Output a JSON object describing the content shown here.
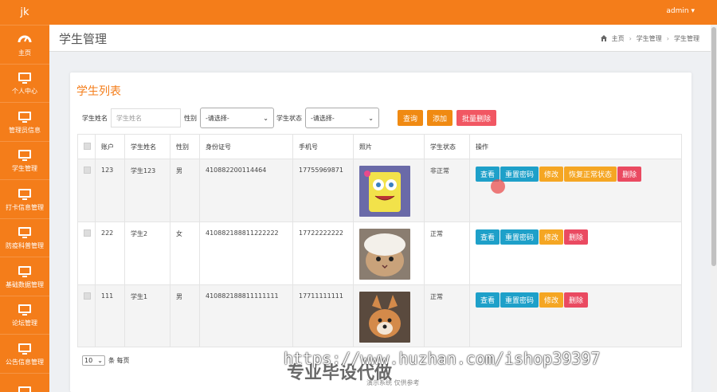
{
  "sidebar": {
    "logo": "jk",
    "items": [
      {
        "label": "主页",
        "icon": "dashboard-icon"
      },
      {
        "label": "个人中心",
        "icon": "monitor-icon"
      },
      {
        "label": "管理员信息",
        "icon": "monitor-icon"
      },
      {
        "label": "学生管理",
        "icon": "monitor-icon"
      },
      {
        "label": "打卡信息管理",
        "icon": "monitor-icon"
      },
      {
        "label": "防疫科普管理",
        "icon": "monitor-icon"
      },
      {
        "label": "基础数据管理",
        "icon": "monitor-icon"
      },
      {
        "label": "论坛管理",
        "icon": "monitor-icon"
      },
      {
        "label": "公告信息管理",
        "icon": "monitor-icon"
      },
      {
        "label": "",
        "icon": "monitor-icon"
      }
    ]
  },
  "topbar": {
    "user": "admin ▾"
  },
  "page": {
    "title": "学生管理",
    "breadcrumb": {
      "home": "主页",
      "b1": "学生管理",
      "b2": "学生管理",
      "sep": "›"
    }
  },
  "card": {
    "title": "学生列表"
  },
  "filters": {
    "name_label": "学生姓名",
    "name_placeholder": "学生姓名",
    "gender_label": "性别",
    "gender_value": "-请选择-",
    "status_label": "学生状态",
    "status_value": "-请选择-",
    "query": "查询",
    "add": "添加",
    "batch_delete": "批量删除"
  },
  "table": {
    "headers": [
      "账户",
      "学生姓名",
      "性别",
      "身份证号",
      "手机号",
      "照片",
      "学生状态",
      "操作"
    ],
    "rows": [
      {
        "account": "123",
        "name": "学生123",
        "gender": "男",
        "id": "410882200114464",
        "phone": "17755969871",
        "status": "非正常"
      },
      {
        "account": "222",
        "name": "学生2",
        "gender": "女",
        "id": "410882188811222222",
        "phone": "17722222222",
        "status": "正常"
      },
      {
        "account": "111",
        "name": "学生1",
        "gender": "男",
        "id": "410882188811111111",
        "phone": "17711111111",
        "status": "正常"
      }
    ],
    "ops": {
      "view": "查看",
      "reset": "重置密码",
      "edit": "修改",
      "restore": "恢复正常状态",
      "delete": "删除"
    }
  },
  "pager": {
    "size": "10",
    "per_page": "条 每页"
  },
  "footer": "演示系统 仅供参考",
  "watermark": {
    "url": "https://www.huzhan.com/ishop39397",
    "text": "专业毕设代做"
  },
  "colors": {
    "brand": "#f47d1a",
    "view": "#1ea0c9",
    "edit": "#f5a623",
    "delete": "#ea4a61"
  }
}
